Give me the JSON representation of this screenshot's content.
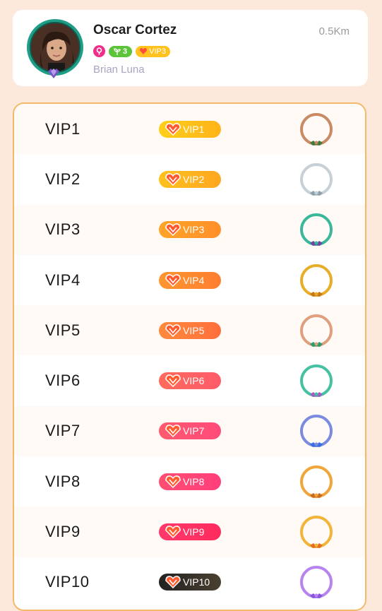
{
  "profile": {
    "name": "Oscar Cortez",
    "distance": "0.5Km",
    "level_badge": "3",
    "vip_badge": "VIP3",
    "subtitle": "Brian Luna"
  },
  "levels": [
    {
      "label": "VIP1",
      "badge": "VIP1",
      "pill_start": "#ffcf1a",
      "pill_end": "#ffb31a",
      "ring": "#c98a66",
      "bow": "#3f7a3a"
    },
    {
      "label": "VIP2",
      "badge": "VIP2",
      "pill_start": "#ffc21f",
      "pill_end": "#ffa61f",
      "ring": "#c6d0d8",
      "bow": "#8fa0ad"
    },
    {
      "label": "VIP3",
      "badge": "VIP3",
      "pill_start": "#ffa528",
      "pill_end": "#ff8f28",
      "ring": "#3cb79a",
      "bow": "#6a4aa0"
    },
    {
      "label": "VIP4",
      "badge": "VIP4",
      "pill_start": "#ff9630",
      "pill_end": "#ff7e30",
      "ring": "#e7ae2a",
      "bow": "#c9761c"
    },
    {
      "label": "VIP5",
      "badge": "VIP5",
      "pill_start": "#ff8a3c",
      "pill_end": "#ff6e3c",
      "ring": "#e0a07f",
      "bow": "#2d9b6e"
    },
    {
      "label": "VIP6",
      "badge": "VIP6",
      "pill_start": "#ff6b5c",
      "pill_end": "#ff5a6a",
      "ring": "#46c1a4",
      "bow": "#a35cc4"
    },
    {
      "label": "VIP7",
      "badge": "VIP7",
      "pill_start": "#ff5a6e",
      "pill_end": "#ff4a7a",
      "ring": "#7b8ce0",
      "bow": "#3a6fe0"
    },
    {
      "label": "VIP8",
      "badge": "VIP8",
      "pill_start": "#ff4e72",
      "pill_end": "#ff3f7c",
      "ring": "#f0a63a",
      "bow": "#c96b22"
    },
    {
      "label": "VIP9",
      "badge": "VIP9",
      "pill_start": "#ff3a6a",
      "pill_end": "#ff2b5e",
      "ring": "#f2b43a",
      "bow": "#e07020"
    },
    {
      "label": "VIP10",
      "badge": "VIP10",
      "pill_start": "#222222",
      "pill_end": "#4a4030",
      "ring": "#b884f0",
      "bow": "#8b55e0"
    }
  ],
  "icons": {
    "gender": "female-icon",
    "level": "sprout-icon",
    "vip": "heart-gem-icon"
  }
}
